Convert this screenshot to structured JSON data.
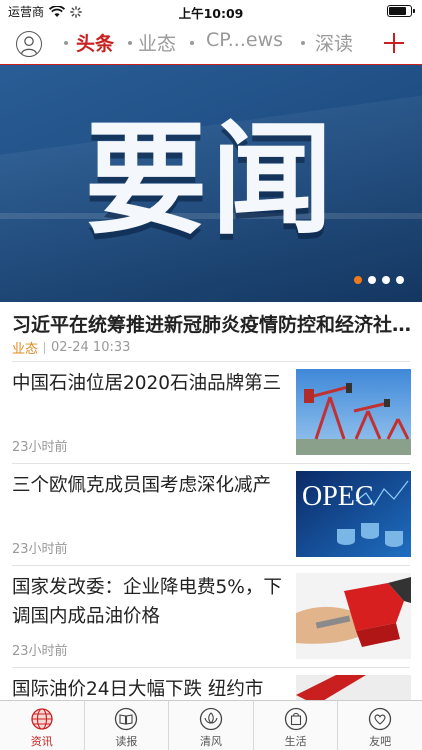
{
  "status_bar": {
    "carrier": "运营商",
    "time": "上午10:09",
    "battery_level": 0.85
  },
  "nav": {
    "tabs": [
      {
        "label": "头条",
        "active": true
      },
      {
        "label": "业态",
        "active": false
      },
      {
        "label": "CP...ews",
        "active": false
      },
      {
        "label": "深读",
        "active": false
      }
    ]
  },
  "banner": {
    "title": "要闻",
    "slide_count": 4,
    "current_slide": 1
  },
  "headline": {
    "title": "习近平在统筹推进新冠肺炎疫情防控和经济社会发展工作部署会议上的讲话",
    "category": "业态",
    "date": "02-24 10:33"
  },
  "news": [
    {
      "title": "中国石油位居2020石油品牌第三",
      "time": "23小时前",
      "thumb": "oil-pumpjack-image"
    },
    {
      "title": "三个欧佩克成员国考虑深化减产",
      "time": "23小时前",
      "thumb": "opec-image",
      "thumb_text": "OPEC"
    },
    {
      "title": "国家发改委：企业降电费5%，下调国内成品油价格",
      "time": "23小时前",
      "thumb": "fuel-nozzle-image"
    },
    {
      "title": "国际油价24日大幅下跌 纽约市",
      "time": "",
      "thumb": "red-image"
    }
  ],
  "tabbar": {
    "items": [
      {
        "label": "资讯",
        "icon": "globe-icon",
        "active": true
      },
      {
        "label": "读报",
        "icon": "book-icon",
        "active": false
      },
      {
        "label": "清风",
        "icon": "lotus-icon",
        "active": false
      },
      {
        "label": "生活",
        "icon": "shopping-bag-icon",
        "active": false
      },
      {
        "label": "友吧",
        "icon": "heart-hands-icon",
        "active": false
      }
    ]
  },
  "colors": {
    "accent": "#c9201f",
    "category": "#e08a1e",
    "banner_blue": "#1f4f85"
  }
}
